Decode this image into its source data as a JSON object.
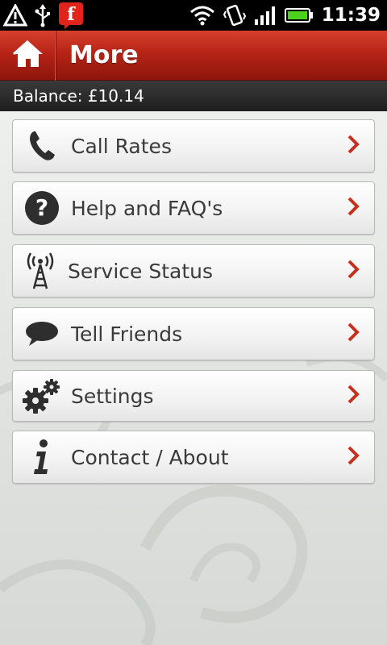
{
  "status_bar": {
    "time": "11:39",
    "icons": [
      "warning-icon",
      "usb-icon",
      "flipboard-icon",
      "wifi-icon",
      "vibrate-icon",
      "signal-icon",
      "battery-icon"
    ]
  },
  "header": {
    "title": "More",
    "home_icon": "home-icon"
  },
  "balance": {
    "text": "Balance: £10.14"
  },
  "menu": {
    "items": [
      {
        "label": "Call Rates",
        "icon": "phone-icon"
      },
      {
        "label": "Help and FAQ's",
        "icon": "help-icon"
      },
      {
        "label": "Service Status",
        "icon": "antenna-icon"
      },
      {
        "label": "Tell Friends",
        "icon": "speech-bubble-icon"
      },
      {
        "label": "Settings",
        "icon": "gears-icon"
      },
      {
        "label": "Contact / About",
        "icon": "info-icon"
      }
    ]
  },
  "colors": {
    "header_red": "#b72417",
    "chevron_red": "#c4321f",
    "battery_green": "#4cd11f"
  }
}
